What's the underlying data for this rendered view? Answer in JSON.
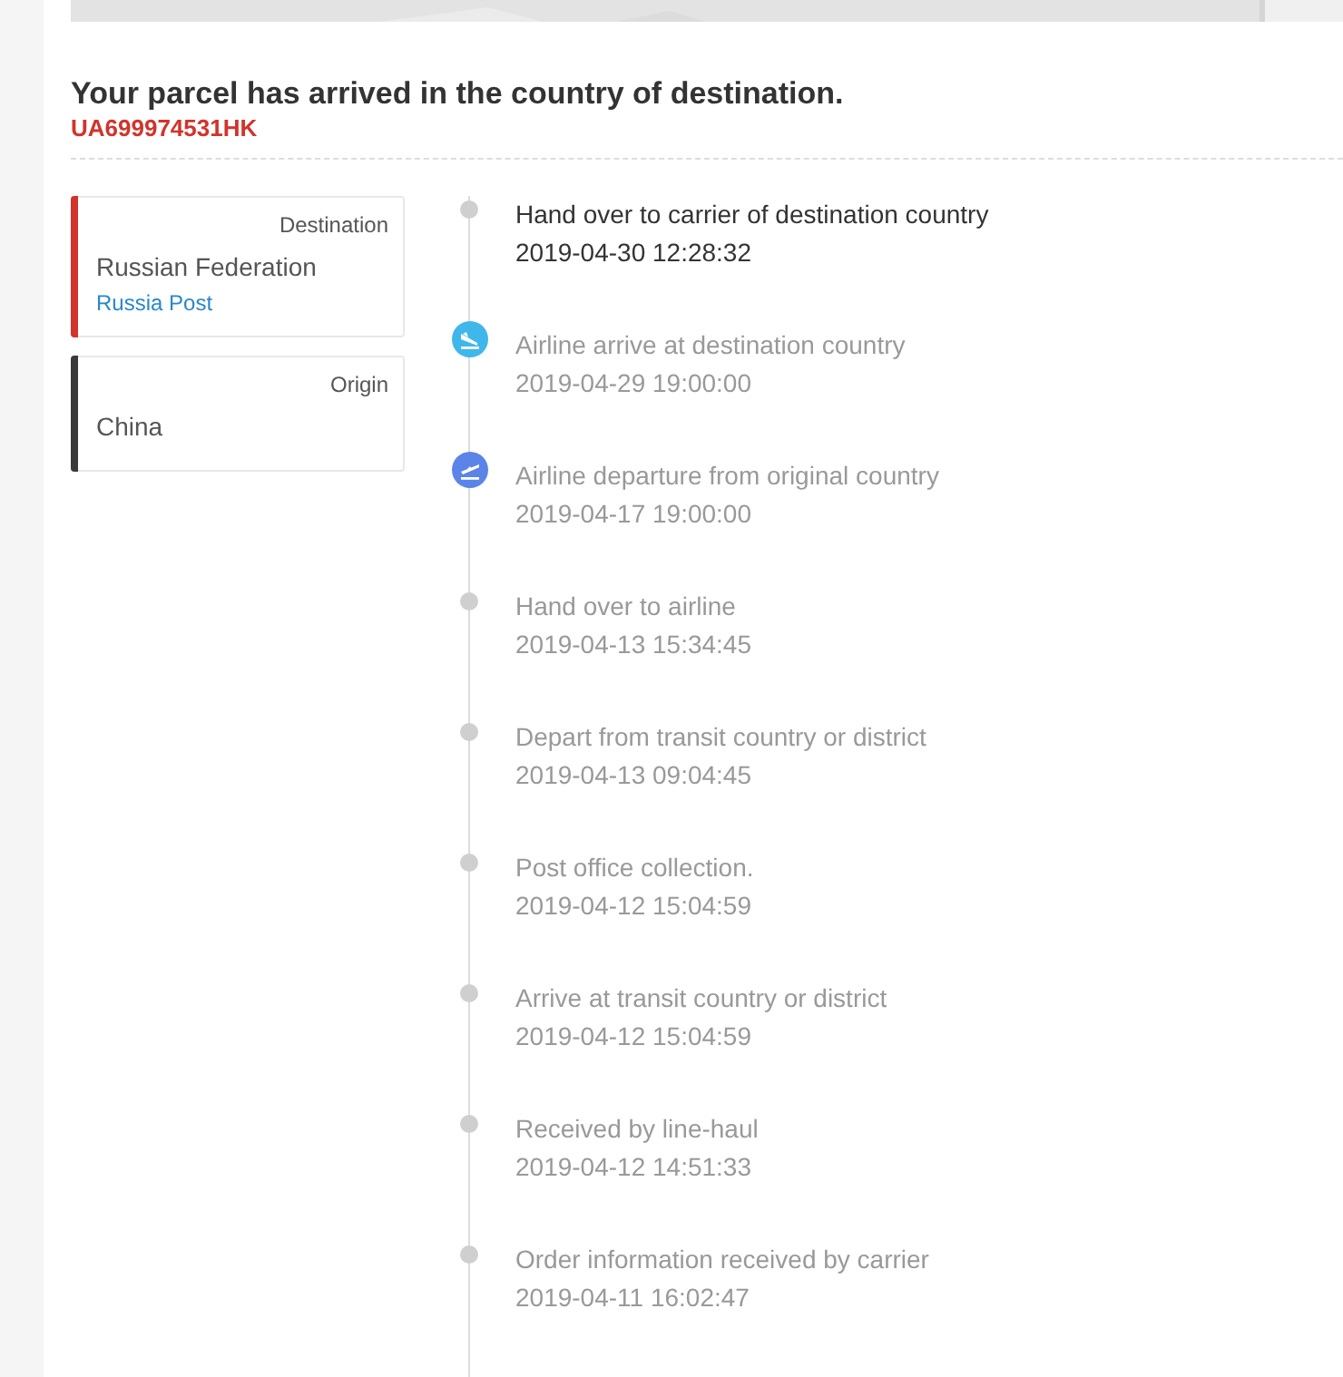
{
  "status": {
    "title": "Your parcel has arrived in the country of destination.",
    "tracking_number": "UA699974531HK"
  },
  "route": [
    {
      "label": "Destination",
      "country": "Russian Federation",
      "carrier": "Russia Post",
      "color": "#d0342c"
    },
    {
      "label": "Origin",
      "country": "China",
      "color": "#3a3a3a"
    }
  ],
  "events": [
    {
      "kind": "dot",
      "latest": true,
      "text": "Hand over to carrier of destination country",
      "time": "2019-04-30 12:28:32"
    },
    {
      "kind": "arrival",
      "latest": false,
      "text": "Airline arrive at destination country",
      "time": "2019-04-29 19:00:00"
    },
    {
      "kind": "departure",
      "latest": false,
      "text": "Airline departure from original country",
      "time": "2019-04-17 19:00:00"
    },
    {
      "kind": "dot",
      "latest": false,
      "text": "Hand over to airline",
      "time": "2019-04-13 15:34:45"
    },
    {
      "kind": "dot",
      "latest": false,
      "text": "Depart from transit country or district",
      "time": "2019-04-13 09:04:45"
    },
    {
      "kind": "dot",
      "latest": false,
      "text": "Post office collection.",
      "time": "2019-04-12 15:04:59"
    },
    {
      "kind": "dot",
      "latest": false,
      "text": "Arrive at transit country or district",
      "time": "2019-04-12 15:04:59"
    },
    {
      "kind": "dot",
      "latest": false,
      "text": "Received by line-haul",
      "time": "2019-04-12 14:51:33"
    },
    {
      "kind": "dot",
      "latest": false,
      "text": "Order information received by carrier",
      "time": "2019-04-11 16:02:47"
    }
  ]
}
